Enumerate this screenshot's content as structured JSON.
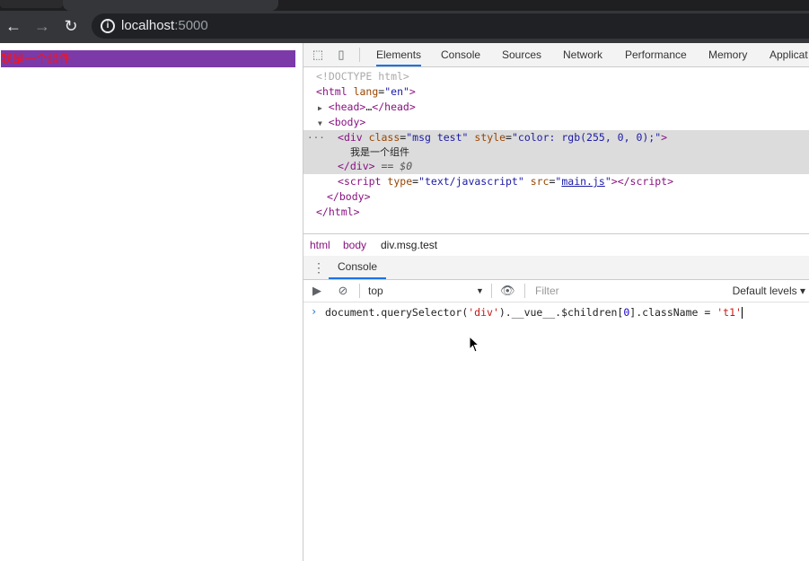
{
  "browser": {
    "url_host": "localhost",
    "url_port": ":5000",
    "icons": {
      "back": "arrow-left-icon",
      "forward": "arrow-right-icon",
      "reload": "reload-icon",
      "info": "info-icon"
    }
  },
  "page": {
    "component_text": "我是一个组件",
    "component_bg": "#7b3aa8",
    "component_color": "#ff1010"
  },
  "devtools": {
    "tabs": [
      "Elements",
      "Console",
      "Sources",
      "Network",
      "Performance",
      "Memory",
      "Applicat"
    ],
    "active_tab": "Elements",
    "dom": {
      "doctype": "<!DOCTYPE html>",
      "html_open_tag": "html",
      "html_lang_attr": "lang",
      "html_lang_val": "\"en\"",
      "head_collapsed": "head",
      "head_ellipsis": "…",
      "body_tag": "body",
      "div_tag": "div",
      "div_class_attr": "class",
      "div_class_val": "\"msg test\"",
      "div_style_attr": "style",
      "div_style_val": "\"color: rgb(255, 0, 0);\"",
      "div_text": "我是一个组件",
      "div_close_suffix": " == $0",
      "script_tag": "script",
      "script_type_attr": "type",
      "script_type_val": "\"text/javascript\"",
      "script_src_attr": "src",
      "script_src_val": "main.js"
    },
    "breadcrumb": [
      "html",
      "body",
      "div.msg.test"
    ],
    "drawer": {
      "tab": "Console",
      "context": "top",
      "filter_placeholder": "Filter",
      "levels": "Default levels ▾",
      "command_prefix": "document.querySelector(",
      "command_str1": "'div'",
      "command_mid": ").__vue__.$children[",
      "command_num": "0",
      "command_mid2": "].className = ",
      "command_str2": "'t1'"
    }
  }
}
